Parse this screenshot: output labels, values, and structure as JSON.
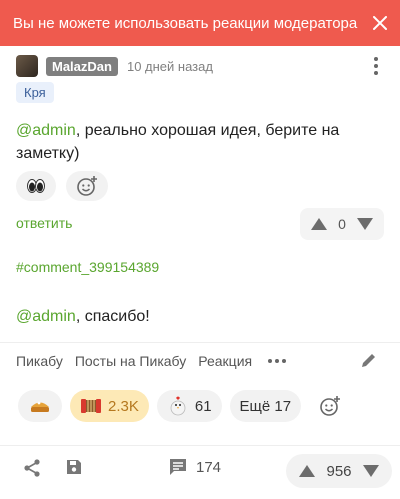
{
  "toast": {
    "message": "Вы не можете использовать реакции модератора",
    "color": "#ef5a4e"
  },
  "comment": {
    "username": "MalazDan",
    "time_ago": "10 дней назад",
    "tag": "Кря",
    "mention": "@admin",
    "text_rest": ", реально хорошая идея, берите на заметку)",
    "reply_label": "ответить",
    "rating": "0",
    "reactions": [
      "eyes",
      "add-reaction"
    ]
  },
  "reply_comment": {
    "hash_link": "#comment_399154389",
    "mention": "@admin",
    "text_rest": ", спасибо!"
  },
  "nav": {
    "items": [
      "Пикабу",
      "Посты на Пикабу",
      "Реакция"
    ]
  },
  "post_reactions": {
    "pie": "",
    "accordion_count": "2.3K",
    "chicken_count": "61",
    "more_label": "Ещё 17"
  },
  "footer": {
    "comments_count": "174",
    "rating": "956"
  },
  "colors": {
    "accent_green": "#5aa62f",
    "active_pill": "#fde9b6",
    "active_text": "#b5781f"
  }
}
